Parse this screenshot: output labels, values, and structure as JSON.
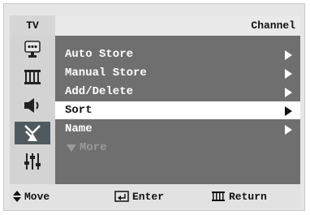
{
  "header": {
    "source_label": "TV",
    "title": "Channel"
  },
  "sidebar": {
    "icons": [
      {
        "name": "picture-icon",
        "active": false
      },
      {
        "name": "channel-list-icon",
        "active": false
      },
      {
        "name": "sound-icon",
        "active": false
      },
      {
        "name": "antenna-icon",
        "active": true
      },
      {
        "name": "setup-sliders-icon",
        "active": false
      }
    ]
  },
  "menu": {
    "items": [
      {
        "label": "Auto Store",
        "selected": false
      },
      {
        "label": "Manual Store",
        "selected": false
      },
      {
        "label": "Add/Delete",
        "selected": false
      },
      {
        "label": "Sort",
        "selected": true
      },
      {
        "label": "Name",
        "selected": false
      }
    ],
    "more_label": "More"
  },
  "footer": {
    "move_label": "Move",
    "enter_label": "Enter",
    "return_label": "Return"
  },
  "colors": {
    "menu_bg": "#6f6f6f",
    "selected_bg": "#ffffff",
    "active_icon_bg": "#505a5e"
  }
}
